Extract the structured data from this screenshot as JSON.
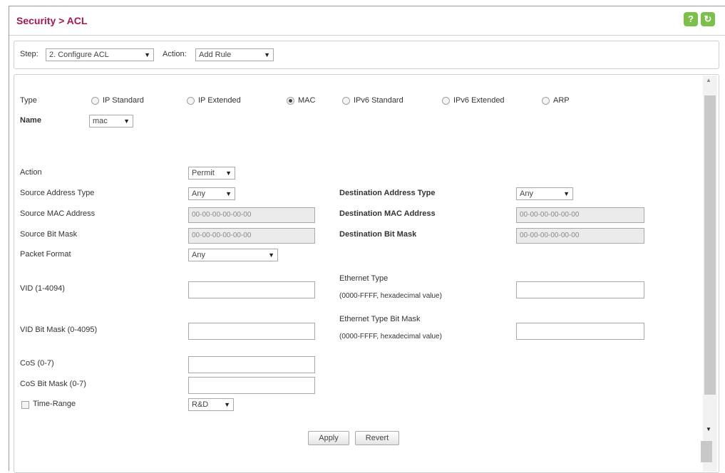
{
  "header": {
    "title": "Security > ACL",
    "help_icon": "?",
    "refresh_icon": "↻"
  },
  "step_bar": {
    "step_label": "Step:",
    "step_value": "2. Configure ACL",
    "action_label": "Action:",
    "action_value": "Add Rule"
  },
  "type_row": {
    "label": "Type",
    "options": [
      "IP Standard",
      "IP Extended",
      "MAC",
      "IPv6 Standard",
      "IPv6 Extended",
      "ARP"
    ],
    "selected": "MAC"
  },
  "name_row": {
    "label": "Name",
    "value": "mac"
  },
  "form": {
    "action_label": "Action",
    "action_value": "Permit",
    "src_type_label": "Source Address Type",
    "src_type_value": "Any",
    "dst_type_label": "Destination Address Type",
    "dst_type_value": "Any",
    "src_mac_label": "Source MAC Address",
    "src_mac_value": "00-00-00-00-00-00",
    "dst_mac_label": "Destination MAC Address",
    "dst_mac_value": "00-00-00-00-00-00",
    "src_mask_label": "Source Bit Mask",
    "src_mask_value": "00-00-00-00-00-00",
    "dst_mask_label": "Destination Bit Mask",
    "dst_mask_value": "00-00-00-00-00-00",
    "packet_format_label": "Packet Format",
    "packet_format_value": "Any",
    "vid_label": "VID (1-4094)",
    "vid_value": "",
    "eth_type_label": "Ethernet Type",
    "eth_type_hint": "(0000-FFFF, hexadecimal value)",
    "eth_type_value": "",
    "vid_mask_label": "VID Bit Mask (0-4095)",
    "vid_mask_value": "",
    "eth_mask_label": "Ethernet Type Bit Mask",
    "eth_mask_hint": "(0000-FFFF, hexadecimal value)",
    "eth_mask_value": "",
    "cos_label": "CoS (0-7)",
    "cos_value": "",
    "cos_mask_label": "CoS Bit Mask (0-7)",
    "cos_mask_value": "",
    "time_range_label": "Time-Range",
    "time_range_value": "R&D"
  },
  "buttons": {
    "apply": "Apply",
    "revert": "Revert"
  }
}
